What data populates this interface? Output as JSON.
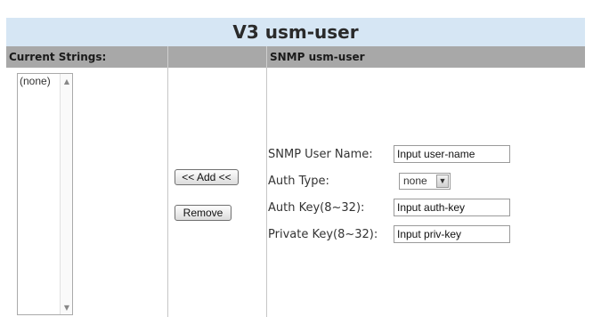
{
  "title": "V3 usm-user",
  "columns": {
    "left_header": "Current Strings:",
    "middle_header": "",
    "right_header": "SNMP usm-user"
  },
  "strings_list": {
    "items": [
      "(none)"
    ]
  },
  "actions": {
    "add_label": "<< Add <<",
    "remove_label": "Remove"
  },
  "form": {
    "user_name_label": "SNMP User Name:",
    "user_name_value": "Input user-name",
    "auth_type_label": "Auth Type:",
    "auth_type_value": "none",
    "auth_key_label": "Auth Key(8~32):",
    "auth_key_value": "Input auth-key",
    "private_key_label": "Private Key(8~32):",
    "private_key_value": "Input priv-key"
  },
  "icons": {
    "scroll_up": "scroll-up-icon",
    "scroll_down": "scroll-down-icon",
    "dropdown": "chevron-down-icon"
  }
}
